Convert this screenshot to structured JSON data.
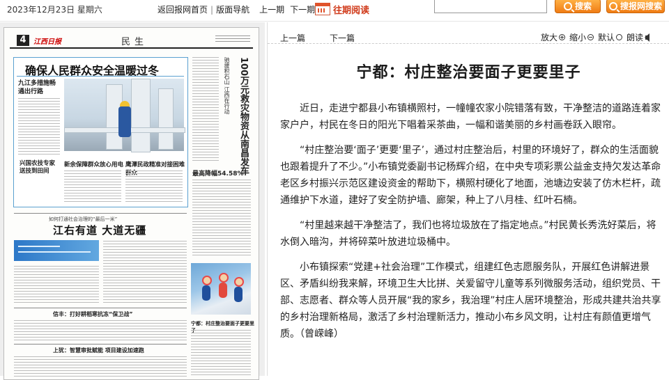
{
  "topbar": {
    "date": "2023年12月23日 星期六",
    "nav": {
      "home": "返回报网首页",
      "sep": "|",
      "layout": "版面导航",
      "prev_issue": "上一期",
      "next_issue": "下一期"
    },
    "past_reading": "往期阅读",
    "search_button": "搜索",
    "search_all_button": "搜报网搜索"
  },
  "newspaper": {
    "page_number": "4",
    "logo": "江西日报",
    "section": "民生",
    "headline_main": "确保人民群众安全温暖过冬",
    "sub_left": "九江多措施畅通出行路",
    "sub_bottom_left": "兴国农技专家送技到田间",
    "sub_bottom_mid": "新余保障群众放心用电",
    "sub_bottom_right": "鹰潭民政精准对接困难群众",
    "vertical_headline": "100万元救灾物资从南昌发车",
    "vertical_small": "驰援积石山 江西在行动",
    "right_head": "最高降幅54.58%",
    "mid_small": "如何打通社会治理的“最后一米”",
    "headline_second": "江右有道 大道无疆",
    "bold_line_1": "信丰：打好耕稻寒抗冻“保卫战”",
    "bold_line_2": "上犹：智慧审批赋能 项目建设加速跑",
    "right_caption": "宁都：村庄整治要面子更要里子"
  },
  "article": {
    "prev": "上一篇",
    "next": "下一篇",
    "tools": {
      "zoom_in": "放大",
      "zoom_out": "缩小",
      "default": "默认",
      "read": "朗读"
    },
    "title": "宁都：村庄整治要面子更要里子",
    "paragraphs": [
      "近日，走进宁都县小布镇横照村，一幢幢农家小院错落有致，干净整洁的道路连着家家户户，村民在冬日的阳光下唱着采茶曲，一幅和谐美丽的乡村画卷跃入眼帘。",
      "“村庄整治要‘面子’更要‘里子’，通过村庄整治后，村里的环境好了，群众的生活面貌也跟着提升了不少。”小布镇党委副书记杨辉介绍，在中央专项彩票公益金支持欠发达革命老区乡村振兴示范区建设资金的帮助下，横照村硬化了地面，池塘边安装了仿木栏杆，疏通维护下水道，建好了安全防护墙、廊架，种上了八月桂、红叶石楠。",
      "“村里越来越干净整洁了，我们也将垃圾放在了指定地点。”村民黄长秀洗好菜后，将水倒入暗沟，并将碎菜叶放进垃圾桶中。",
      "小布镇探索“党建+社会治理”工作模式，组建红色志愿服务队，开展红色讲解进景区、矛盾纠纷我来解，环境卫生大比拼、关爱留守儿童等系列微服务活动，组织党员、干部、志愿者、群众等人员开展“我的家乡，我治理”村庄人居环境整治，形成共建共治共享的乡村治理新格局，激活了乡村治理新活力，推动小布乡风文明，让村庄有颜值更增气质。（曾嵘峰）"
    ]
  }
}
